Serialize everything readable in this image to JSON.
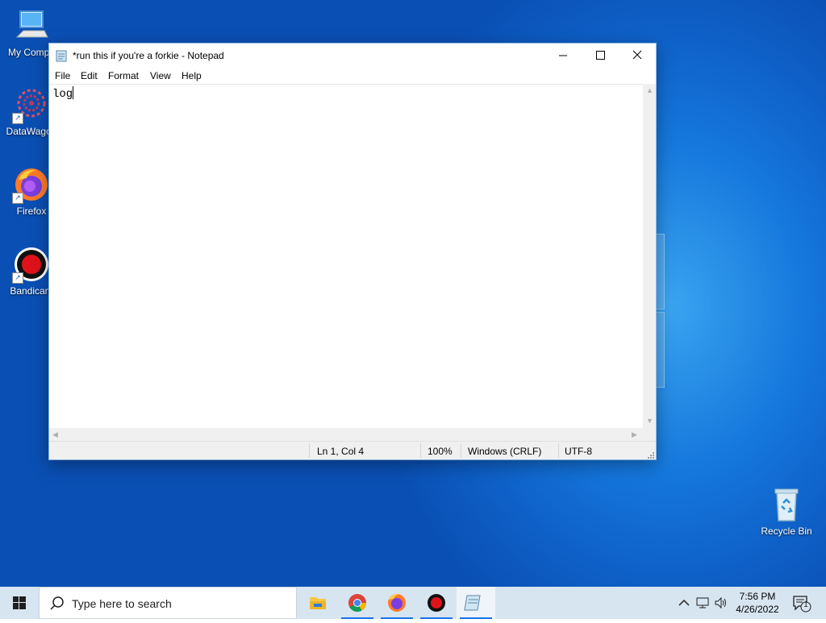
{
  "desktop": {
    "icons": [
      {
        "label": "My Compu"
      },
      {
        "label": "DataWagon"
      },
      {
        "label": "Firefox"
      },
      {
        "label": "Bandicam"
      },
      {
        "label": "Recycle Bin"
      }
    ]
  },
  "notepad": {
    "title": "*run this if you're a forkie - Notepad",
    "menu": {
      "file": "File",
      "edit": "Edit",
      "format": "Format",
      "view": "View",
      "help": "Help"
    },
    "content": "log",
    "status": {
      "position": "Ln 1, Col 4",
      "zoom": "100%",
      "line_ending": "Windows (CRLF)",
      "encoding": "UTF-8"
    }
  },
  "taskbar": {
    "search_placeholder": "Type here to search",
    "apps": [
      "file-explorer-icon",
      "chrome-icon",
      "firefox-icon",
      "bandicam-icon",
      "notepad-icon"
    ],
    "clock": {
      "time": "7:56 PM",
      "date": "4/26/2022"
    },
    "notification_count": "1"
  },
  "colors": {
    "accent": "#1a73e8",
    "desktop": "#1577dc"
  }
}
